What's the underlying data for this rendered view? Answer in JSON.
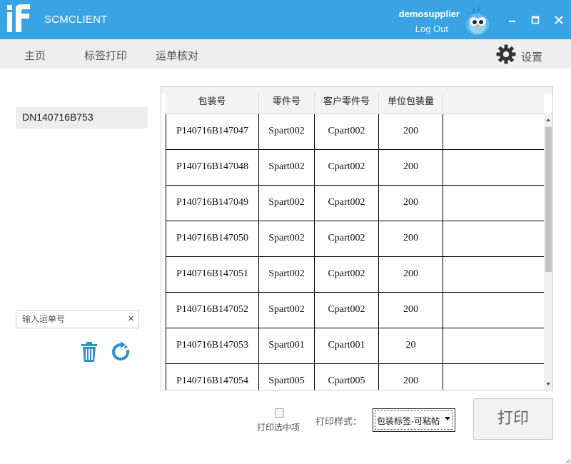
{
  "window": {
    "app_name": "SCMCLIENT",
    "logo_text": "iF",
    "username": "demosupplier",
    "logout_label": "Log Out",
    "colors": {
      "titlebar": "#3aa3e3",
      "menubar": "#eeeeee"
    }
  },
  "menu": {
    "items": [
      {
        "label": "主页"
      },
      {
        "label": "标签打印"
      },
      {
        "label": "运单核对"
      }
    ],
    "settings_label": "设置"
  },
  "left_panel": {
    "waybills": [
      "DN140716B753"
    ],
    "input_placeholder": "输入运单号",
    "input_value": "",
    "clear_icon": "×"
  },
  "table": {
    "columns": [
      "包装号",
      "零件号",
      "客户零件号",
      "单位包装量"
    ],
    "rows": [
      [
        "P140716B147047",
        "Spart002",
        "Cpart002",
        "200"
      ],
      [
        "P140716B147048",
        "Spart002",
        "Cpart002",
        "200"
      ],
      [
        "P140716B147049",
        "Spart002",
        "Cpart002",
        "200"
      ],
      [
        "P140716B147050",
        "Spart002",
        "Cpart002",
        "200"
      ],
      [
        "P140716B147051",
        "Spart002",
        "Cpart002",
        "200"
      ],
      [
        "P140716B147052",
        "Spart002",
        "Cpart002",
        "200"
      ],
      [
        "P140716B147053",
        "Spart001",
        "Cpart001",
        "20"
      ],
      [
        "P140716B147054",
        "Spart005",
        "Cpart005",
        "200"
      ]
    ]
  },
  "footer": {
    "print_selected_label": "打印选中项",
    "print_style_label": "打印样式：",
    "print_style_value": "包装标签-可粘帖",
    "print_button_label": "打印"
  }
}
